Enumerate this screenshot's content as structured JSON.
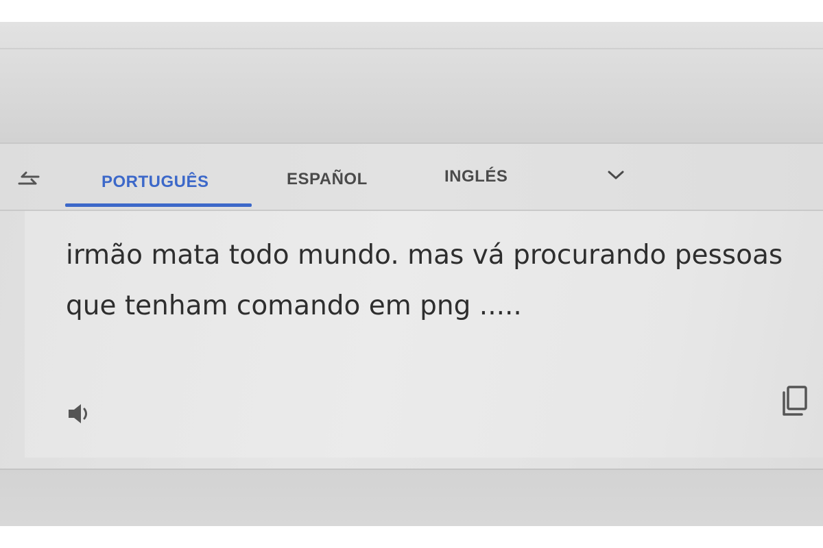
{
  "language_bar": {
    "tabs": [
      {
        "label": "PORTUGUÊS",
        "active": true
      },
      {
        "label": "ESPAÑOL",
        "active": false
      },
      {
        "label": "INGLÉS",
        "active": false
      }
    ],
    "swap_icon": "swap-arrows-icon",
    "more_icon": "chevron-down-icon"
  },
  "input": {
    "text": "irmão mata todo mundo. mas vá procurando pessoas que tenham comando em png .....",
    "speaker_icon": "speaker-icon",
    "copy_icon": "copy-icon"
  },
  "colors": {
    "accent": "#3c68c9",
    "text": "#2e2e2e",
    "tab_inactive": "#4a4a4a",
    "background": "#e6e6e6"
  }
}
